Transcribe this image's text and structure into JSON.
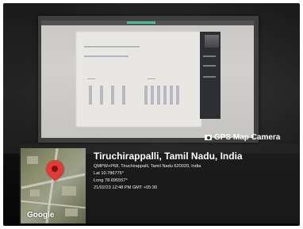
{
  "watermark": {
    "app_name": "GPS Map Camera",
    "icon": "camera-icon"
  },
  "location": {
    "city_line": "Tiruchirappalli, Tamil Nadu, India",
    "address": "QMPW+P68, Tiruchirappalli, Tamil Nadu 620020, India",
    "latitude": "Lat 10.786775°",
    "longitude": "Long 78.695557°",
    "datetime": "21/02/23 12:48 PM GMT +05:30"
  },
  "map": {
    "brand_label": "Google",
    "pin_icon": "map-pin-icon",
    "pin_color": "#e53935"
  }
}
